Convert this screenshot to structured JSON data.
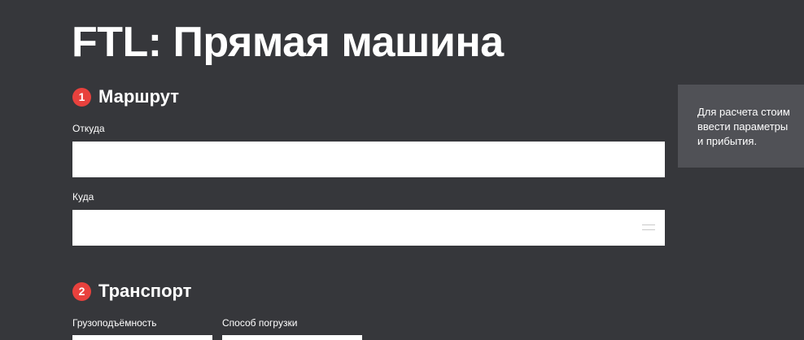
{
  "page": {
    "title": "FTL: Прямая машина"
  },
  "route_section": {
    "step": "1",
    "title": "Маршрут",
    "from_label": "Откуда",
    "from_value": "",
    "to_label": "Куда",
    "to_value": ""
  },
  "transport_section": {
    "step": "2",
    "title": "Транспорт",
    "capacity_label": "Грузоподъёмность",
    "capacity_value": "",
    "loading_label": "Способ погрузки",
    "loading_value": ""
  },
  "tooltip": {
    "lines": [
      "Для расчета стоим",
      "ввести параметры",
      "и прибытия."
    ]
  },
  "icons": {
    "to_field_icon": "list-icon"
  },
  "colors": {
    "background": "#36373b",
    "accent": "#e8413d",
    "tooltip_background": "#505156",
    "input_background": "#ffffff"
  }
}
